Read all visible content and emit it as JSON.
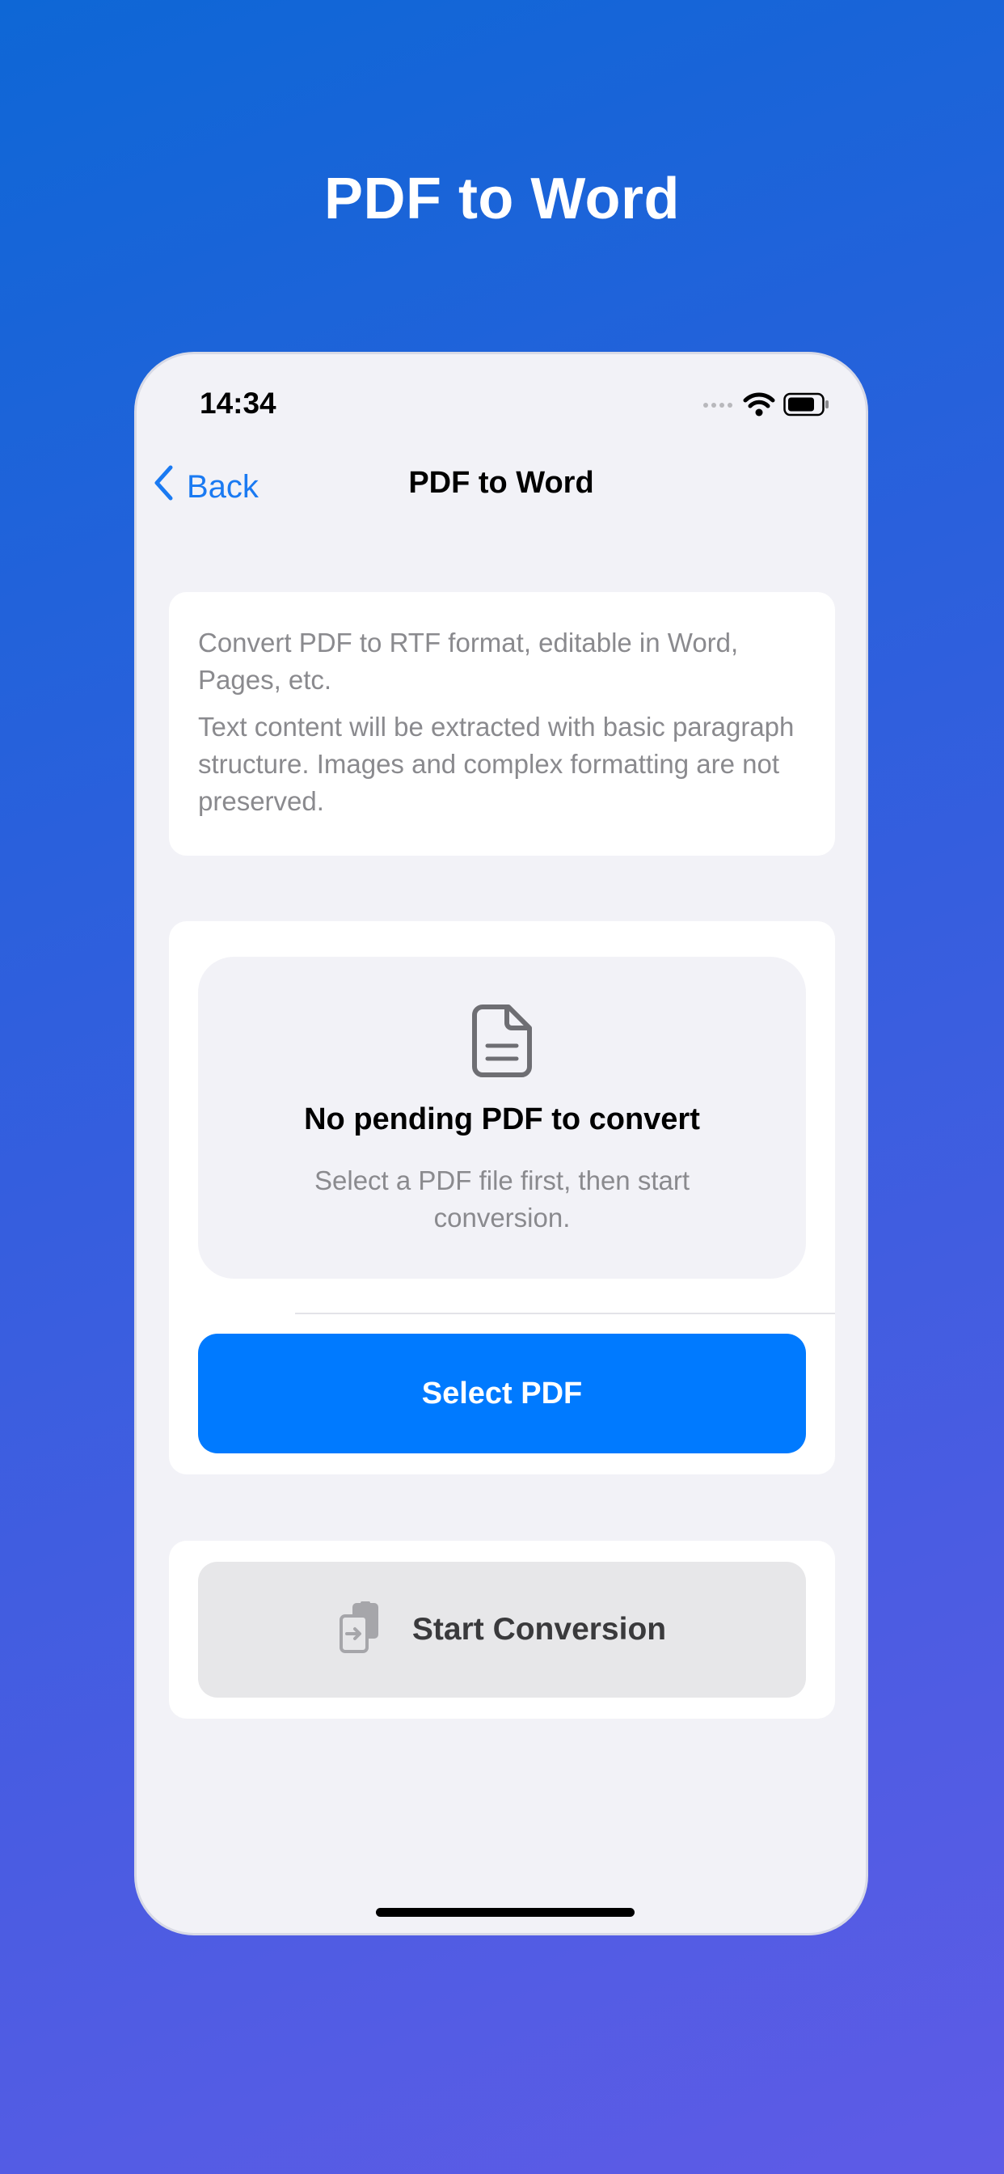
{
  "marketing": {
    "title": "PDF to Word"
  },
  "status_bar": {
    "time": "14:34",
    "icons": [
      "cellular-signal-icon",
      "wifi-icon",
      "battery-icon"
    ]
  },
  "nav": {
    "back_label": "Back",
    "title": "PDF to Word"
  },
  "description": {
    "line1": "Convert PDF to RTF format, editable in Word, Pages, etc.",
    "line2": "Text content will be extracted with basic paragraph structure. Images and complex formatting are not preserved."
  },
  "empty_state": {
    "icon": "document-icon",
    "title": "No pending PDF to convert",
    "subtitle": "Select a PDF file first, then start conversion."
  },
  "actions": {
    "select_pdf_label": "Select PDF",
    "start_conversion_label": "Start Conversion",
    "start_conversion_icon": "convert-document-icon"
  },
  "colors": {
    "accent": "#007aff",
    "disabled_button": "#e7e7e9",
    "secondary_text": "#8a8a8e"
  }
}
